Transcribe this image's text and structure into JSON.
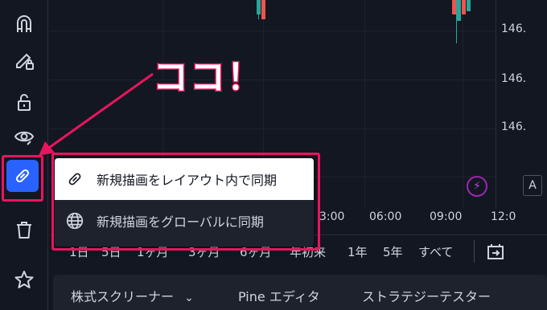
{
  "callout": {
    "text": "ココ！"
  },
  "toolbar": {
    "items": [
      {
        "name": "magnet-icon"
      },
      {
        "name": "pencil-lock-icon"
      },
      {
        "name": "lock-icon"
      },
      {
        "name": "eye-icon"
      },
      {
        "name": "link-icon",
        "active": true
      },
      {
        "name": "trash-icon"
      },
      {
        "name": "star-icon"
      }
    ]
  },
  "chart": {
    "price_labels": [
      "146.",
      "146.",
      "146."
    ],
    "time_labels": [
      "3:00",
      "06:00",
      "09:00",
      "12:0"
    ],
    "up_color": "#26a69a",
    "down_color": "#ef5350"
  },
  "menu": {
    "items": [
      {
        "label": "新規描画をレイアウト内で同期",
        "icon": "link-icon",
        "highlighted": true
      },
      {
        "label": "新規描画をグローバルに同期",
        "icon": "globe-icon",
        "highlighted": false
      }
    ]
  },
  "range_bar": {
    "items": [
      "1日",
      "5日",
      "1ヶ月",
      "3ヶ月",
      "6ヶ月",
      "年初来",
      "1年",
      "5年",
      "すべて"
    ]
  },
  "bottom_tabs": {
    "screener": "株式スクリーナー",
    "screener_chevron": "⌄",
    "pine": "Pine エディタ",
    "strategy": "ストラテジーテスター"
  },
  "badges": {
    "alert": "⚡",
    "auto_scale": "A"
  },
  "colors": {
    "accent": "#2962ff",
    "highlight": "#e8155e",
    "background": "#131722",
    "alert": "#9c27b0"
  }
}
